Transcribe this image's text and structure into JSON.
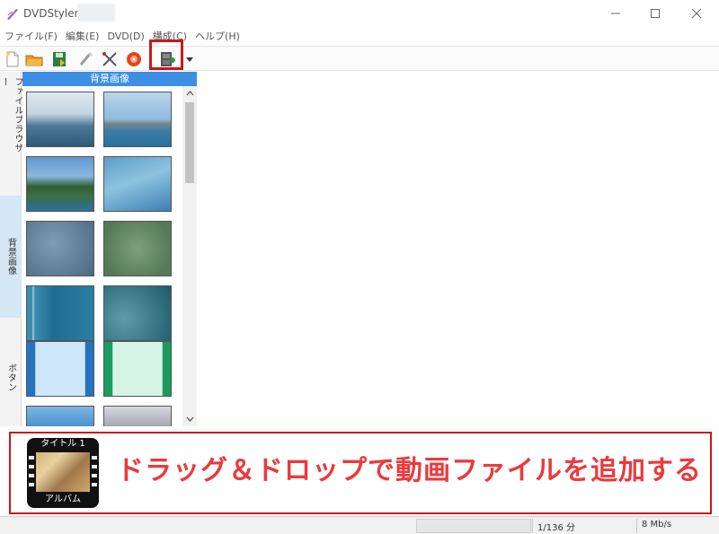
{
  "window": {
    "title": "DVDStyler -",
    "controls": {
      "minimize": "—",
      "maximize": "☐",
      "close": "✕"
    }
  },
  "menu": [
    "ファイル(F)",
    "編集(E)",
    "DVD(D)",
    "構成(C)",
    "ヘルプ(H)"
  ],
  "toolbar": {
    "buttons": [
      "new-icon",
      "open-folder-icon",
      "save-icon",
      "edit-wand-icon",
      "settings-tools-icon",
      "burn-disc-icon",
      "add-video-icon"
    ]
  },
  "side_tabs": {
    "files": "ファイルブラウザー",
    "backgrounds": "背景画像",
    "buttons": "ボタン"
  },
  "panel": {
    "header": "背景画像",
    "thumbnails": [
      "sea-cloudy-sky",
      "sea-boat",
      "coast-cliff",
      "blue-light-rays",
      "blue-gray-texture",
      "green-texture",
      "teal-stripes",
      "teal-grunge",
      "light-blue-frame",
      "green-frame",
      "blue-gradient",
      "gray-gradient"
    ]
  },
  "timeline": {
    "tile_title": "タイトル 1",
    "tile_caption": "アルバム",
    "instruction": "ドラッグ＆ドロップで動画ファイルを追加する"
  },
  "status": {
    "duration": "1/136 分",
    "bitrate": "8 Mb/s"
  },
  "colors": {
    "highlight_border": "#c8171d",
    "instruction_text": "#ea3a3d",
    "panel_header": "#3c8fe2",
    "active_tab": "#d5e6f4"
  }
}
